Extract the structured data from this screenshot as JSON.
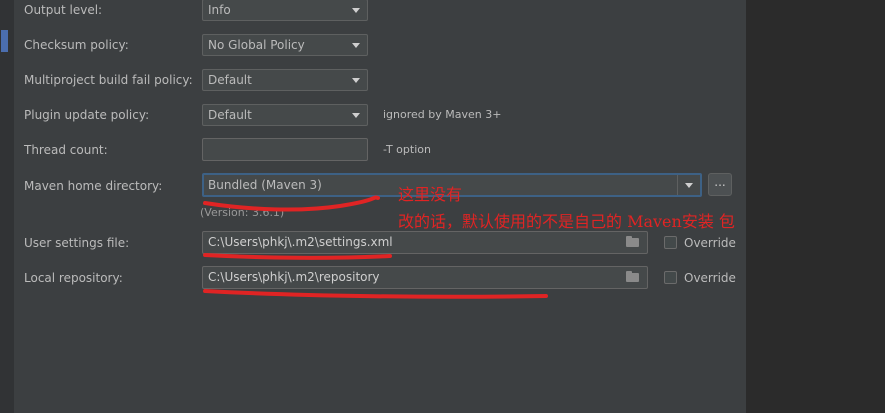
{
  "settings": {
    "output_level": {
      "label": "Output level:",
      "value": "Info"
    },
    "checksum_policy": {
      "label": "Checksum policy:",
      "value": "No Global Policy"
    },
    "multiproject_fail_policy": {
      "label": "Multiproject build fail policy:",
      "value": "Default"
    },
    "plugin_update_policy": {
      "label": "Plugin update policy:",
      "value": "Default",
      "hint": "ignored by Maven 3+"
    },
    "thread_count": {
      "label": "Thread count:",
      "value": "",
      "hint": "-T option"
    },
    "maven_home": {
      "label": "Maven home directory:",
      "value": "Bundled (Maven 3)",
      "version": "(Version: 3.6.1)",
      "browse_label": "..."
    },
    "user_settings": {
      "label": "User settings file:",
      "value": "C:\\Users\\phkj\\.m2\\settings.xml",
      "override_label": "Override",
      "override_checked": false
    },
    "local_repository": {
      "label": "Local repository:",
      "value": "C:\\Users\\phkj\\.m2\\repository",
      "override_label": "Override",
      "override_checked": false
    }
  },
  "annotation": {
    "line1": "这里没有",
    "line2": "改的话，默认使用的不是自己的 Maven安装 包",
    "color": "#e02424"
  },
  "colors": {
    "background": "#3c3f41",
    "field": "#45494a",
    "focus_border": "#3d6185",
    "selection_strip": "#4b6eaf"
  }
}
